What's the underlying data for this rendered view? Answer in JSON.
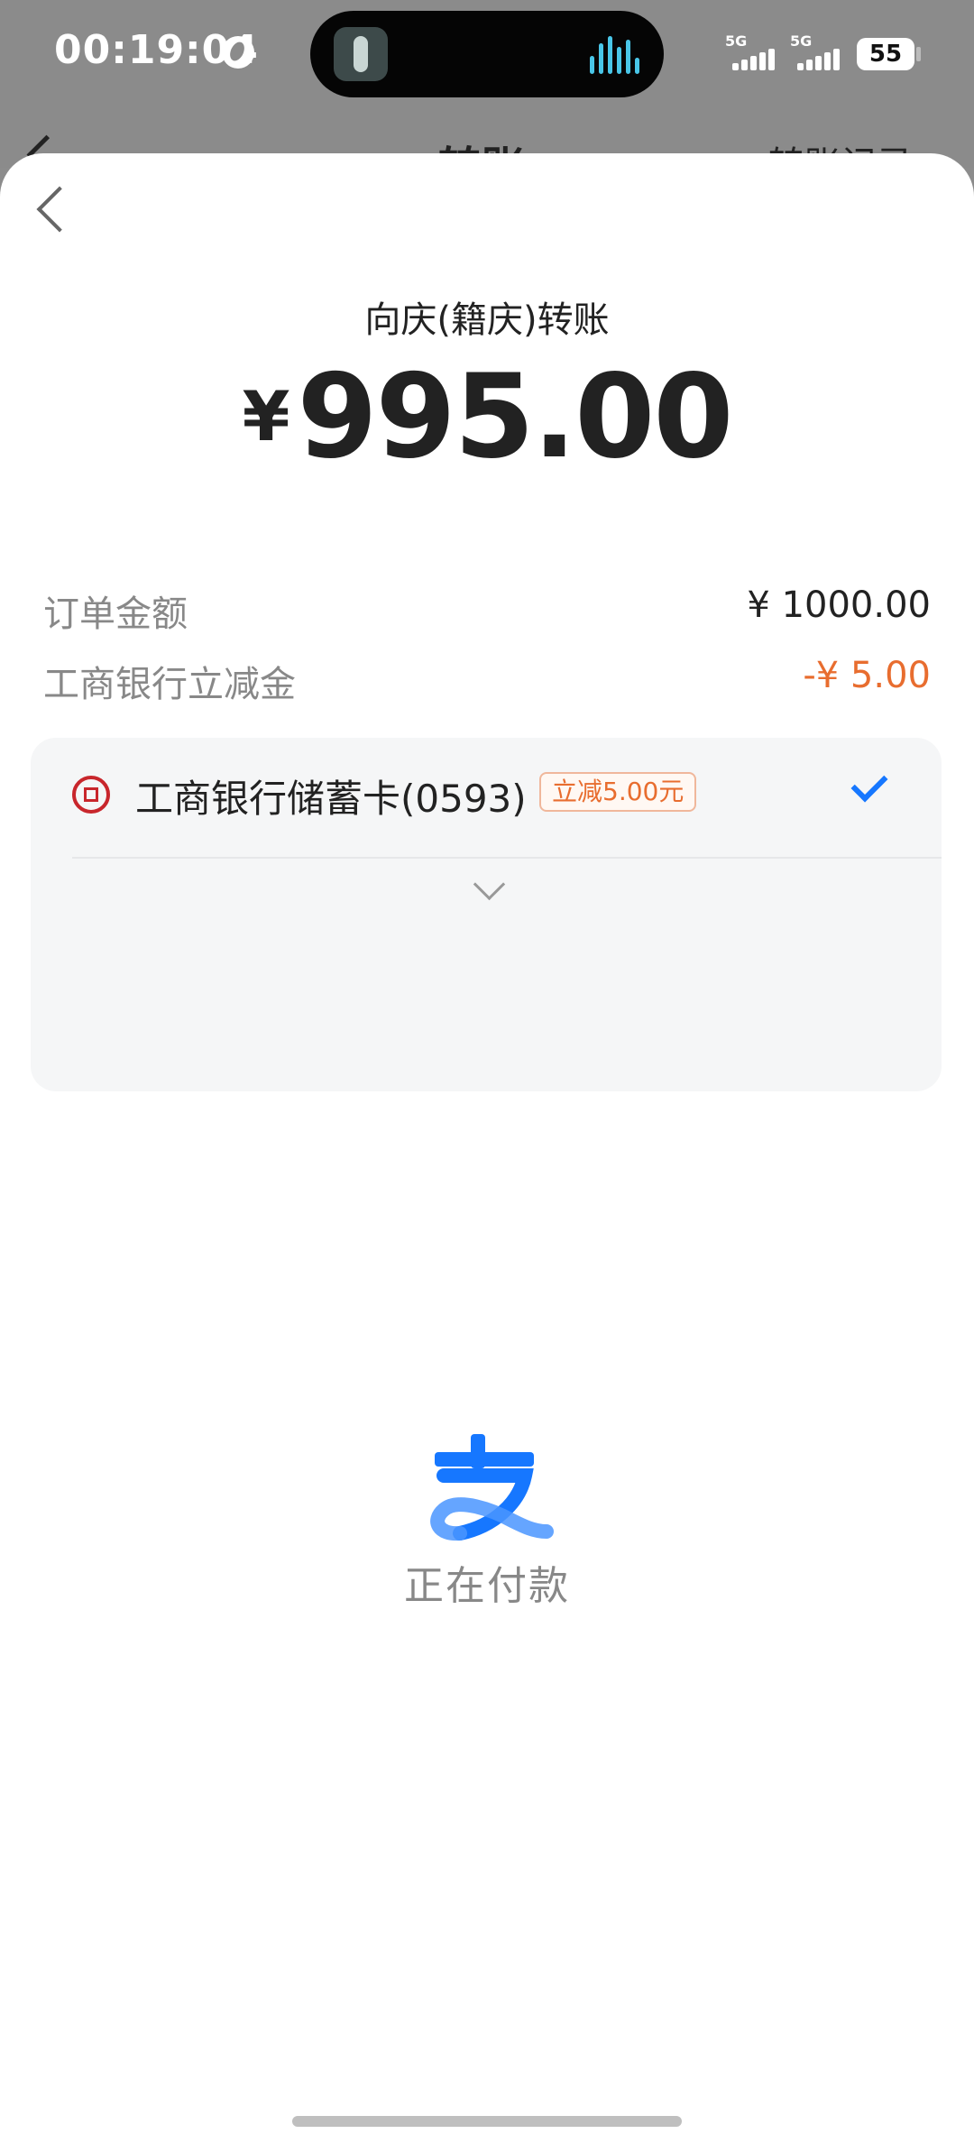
{
  "status_bar": {
    "time": "00:19:04",
    "signal1_label": "5G",
    "signal2_label": "5G",
    "battery": "55"
  },
  "background_nav": {
    "title": "转账",
    "right_link": "转账记录"
  },
  "payment": {
    "payee": "向庆(籍庆)转账",
    "currency_symbol": "¥",
    "amount": "995.00",
    "order_label": "订单金额",
    "order_value": "¥ 1000.00",
    "discount_label": "工商银行立减金",
    "discount_value": "-¥ 5.00"
  },
  "card": {
    "name": "工商银行储蓄卡(0593)",
    "promo": "立减5.00元",
    "bank_icon": "icbc-logo-icon",
    "selected_icon": "checkmark-icon"
  },
  "processing": {
    "logo": "alipay-logo-icon",
    "text": "正在付款"
  },
  "colors": {
    "accent": "#1677ff",
    "discount": "#e86d2f",
    "bank": "#c8262c"
  }
}
